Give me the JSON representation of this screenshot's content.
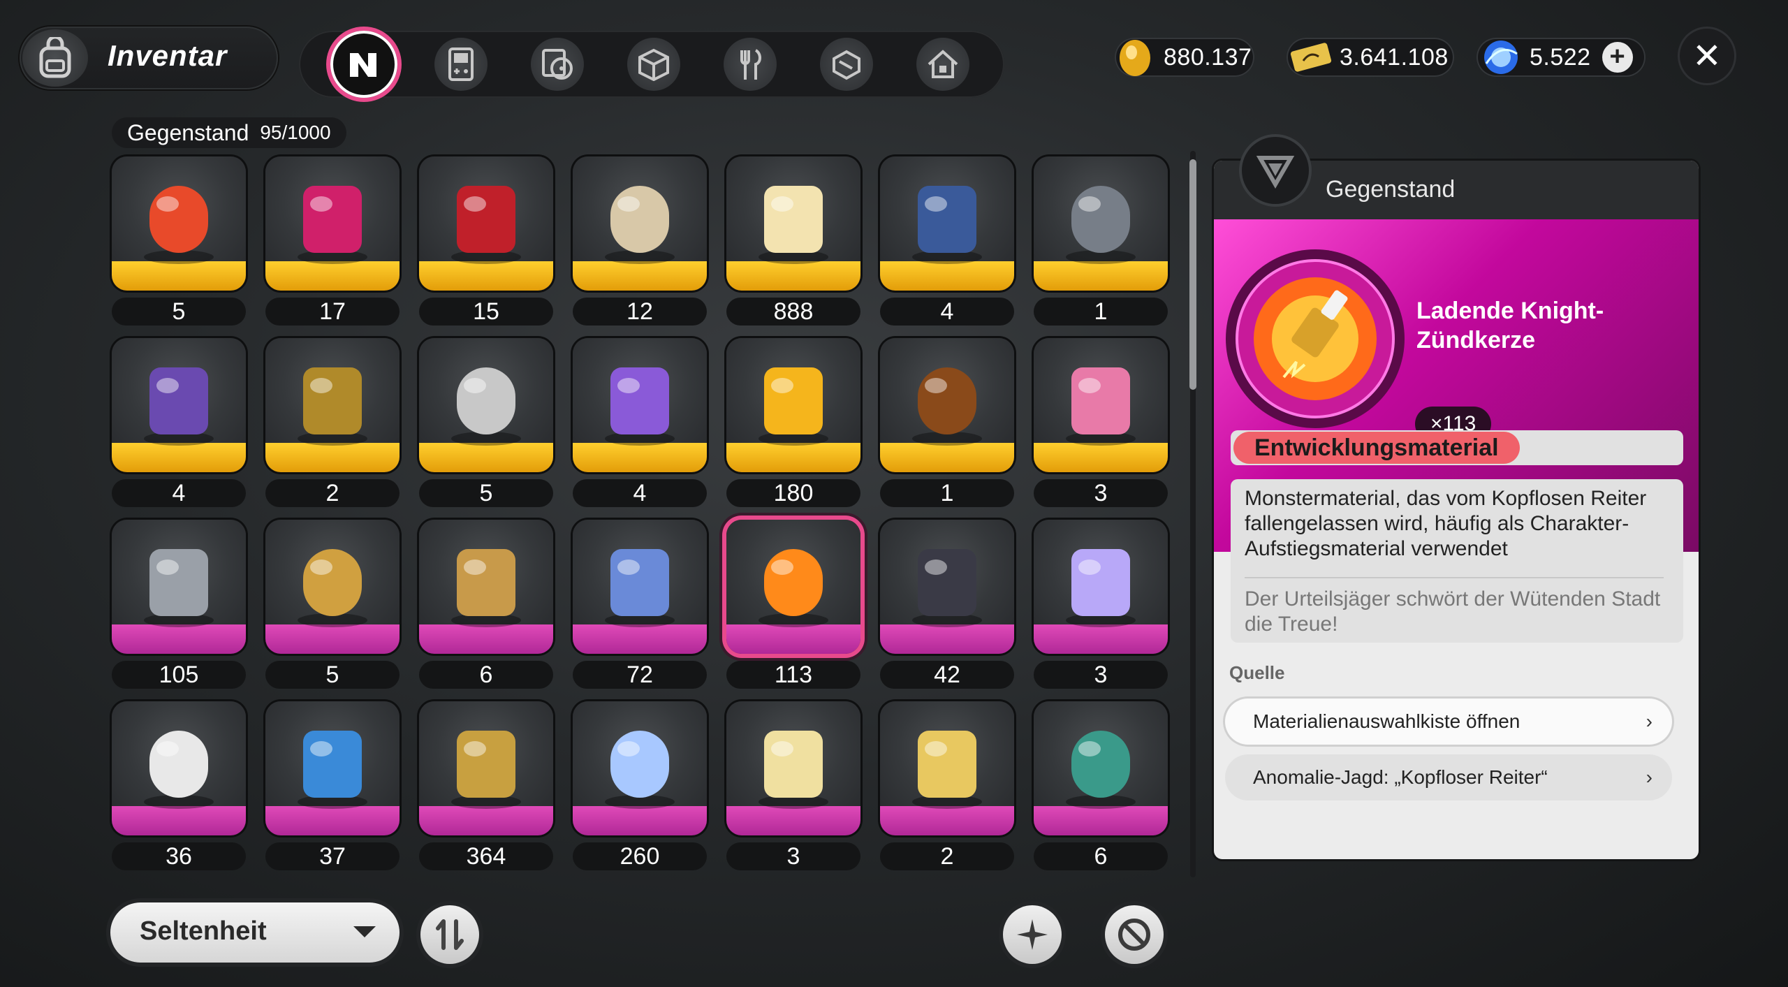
{
  "header": {
    "title": "Inventar",
    "tabs": [
      {
        "icon": "all-items-icon",
        "active": true
      },
      {
        "icon": "gameboy-icon",
        "active": false
      },
      {
        "icon": "disc-icon",
        "active": false
      },
      {
        "icon": "cube-icon",
        "active": false
      },
      {
        "icon": "cutlery-icon",
        "active": false
      },
      {
        "icon": "box-icon",
        "active": false
      },
      {
        "icon": "home-icon",
        "active": false
      }
    ],
    "currencies": [
      {
        "icon": "gold-egg-icon",
        "value": "880.137"
      },
      {
        "icon": "ticket-icon",
        "value": "3.641.108"
      },
      {
        "icon": "blue-orb-icon",
        "value": "5.522"
      }
    ]
  },
  "grid": {
    "label": "Gegenstand",
    "capacity": "95/1000",
    "items": [
      {
        "count": "5",
        "rarity": "gold",
        "icon": "red-orb-icon"
      },
      {
        "count": "17",
        "rarity": "gold",
        "icon": "wax-seal-icon"
      },
      {
        "count": "15",
        "rarity": "gold",
        "icon": "red-cloak-icon"
      },
      {
        "count": "12",
        "rarity": "gold",
        "icon": "melting-clock-icon"
      },
      {
        "count": "888",
        "rarity": "gold",
        "icon": "chess-piece-icon"
      },
      {
        "count": "4",
        "rarity": "gold",
        "icon": "thread-spool-icon"
      },
      {
        "count": "1",
        "rarity": "gold",
        "icon": "key-icon"
      },
      {
        "count": "4",
        "rarity": "gold",
        "icon": "sword-icon"
      },
      {
        "count": "2",
        "rarity": "gold",
        "icon": "belt-icon"
      },
      {
        "count": "5",
        "rarity": "gold",
        "icon": "armor-icon"
      },
      {
        "count": "4",
        "rarity": "gold",
        "icon": "surfboard-icon"
      },
      {
        "count": "180",
        "rarity": "gold",
        "icon": "pixel-coin-icon"
      },
      {
        "count": "1",
        "rarity": "gold",
        "icon": "ticket-card-icon"
      },
      {
        "count": "3",
        "rarity": "gold",
        "icon": "candy-bag-icon"
      },
      {
        "count": "105",
        "rarity": "purple",
        "icon": "tablet-cards-icon"
      },
      {
        "count": "5",
        "rarity": "purple",
        "icon": "tape-deck-icon"
      },
      {
        "count": "6",
        "rarity": "purple",
        "icon": "photo-card-icon"
      },
      {
        "count": "72",
        "rarity": "purple",
        "icon": "crystal-drop-icon"
      },
      {
        "count": "113",
        "rarity": "purple",
        "icon": "spark-plug-icon",
        "selected": true
      },
      {
        "count": "42",
        "rarity": "purple",
        "icon": "dark-envelope-icon"
      },
      {
        "count": "3",
        "rarity": "purple",
        "icon": "guitar-pick-icon"
      },
      {
        "count": "36",
        "rarity": "purple",
        "icon": "mask-icon"
      },
      {
        "count": "37",
        "rarity": "purple",
        "icon": "whale-icon"
      },
      {
        "count": "364",
        "rarity": "purple",
        "icon": "gear-cassette-icon"
      },
      {
        "count": "260",
        "rarity": "purple",
        "icon": "crystal-cluster-icon"
      },
      {
        "count": "3",
        "rarity": "purple",
        "icon": "rose-card-icon"
      },
      {
        "count": "2",
        "rarity": "purple",
        "icon": "golden-card-icon"
      },
      {
        "count": "6",
        "rarity": "purple",
        "icon": "tin-box-icon"
      }
    ]
  },
  "detail": {
    "header": "Gegenstand",
    "name": "Ladende Knight-Zündkerze",
    "quantity": "×113",
    "type": "Entwicklungsmaterial",
    "description": "Monstermaterial, das vom Kopflosen Reiter fallengelassen wird, häufig als Charakter-Aufstiegsmaterial verwendet",
    "flavor": "Der Urteilsjäger schwört der Wütenden Stadt die Treue!",
    "source_label": "Quelle",
    "sources": [
      "Materialienauswahlkiste öffnen",
      "Anomalie-Jagd: „Kopfloser Reiter“"
    ],
    "chevron": "›"
  },
  "controls": {
    "sort_label": "Seltenheit"
  },
  "colors": {
    "accent": "#e84a8c",
    "gold_rarity": "#f5b51c",
    "purple_rarity": "#d0379f",
    "type_tag": "#f0616a"
  }
}
